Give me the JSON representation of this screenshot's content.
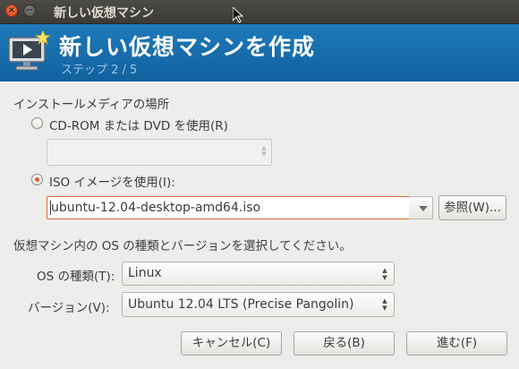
{
  "window": {
    "title": "新しい仮想マシン",
    "close_glyph": "×",
    "minimize_glyph": "−"
  },
  "header": {
    "title": "新しい仮想マシンを作成",
    "step": "ステップ 2 / 5",
    "bg_color": "#12619e"
  },
  "install_media": {
    "section_label": "インストールメディアの場所",
    "cdrom_label": "CD-ROM または DVD を使用(R)",
    "cdrom_selected": false,
    "iso_label": "ISO イメージを使用(I):",
    "iso_selected": true,
    "iso_path": "ubuntu-12.04-desktop-amd64.iso",
    "browse_label": "参照(W)..."
  },
  "os_section": {
    "prompt": "仮想マシン内の OS の種類とバージョンを選択してください。",
    "os_type_label": "OS の種類(T):",
    "os_type_value": "Linux",
    "version_label": "バージョン(V):",
    "version_value": "Ubuntu 12.04 LTS (Precise Pangolin)"
  },
  "buttons": {
    "cancel": "キャンセル(C)",
    "back": "戻る(B)",
    "forward": "進む(F)"
  },
  "colors": {
    "accent": "#e25d29",
    "header": "#1b73b4",
    "background": "#ededeb"
  }
}
